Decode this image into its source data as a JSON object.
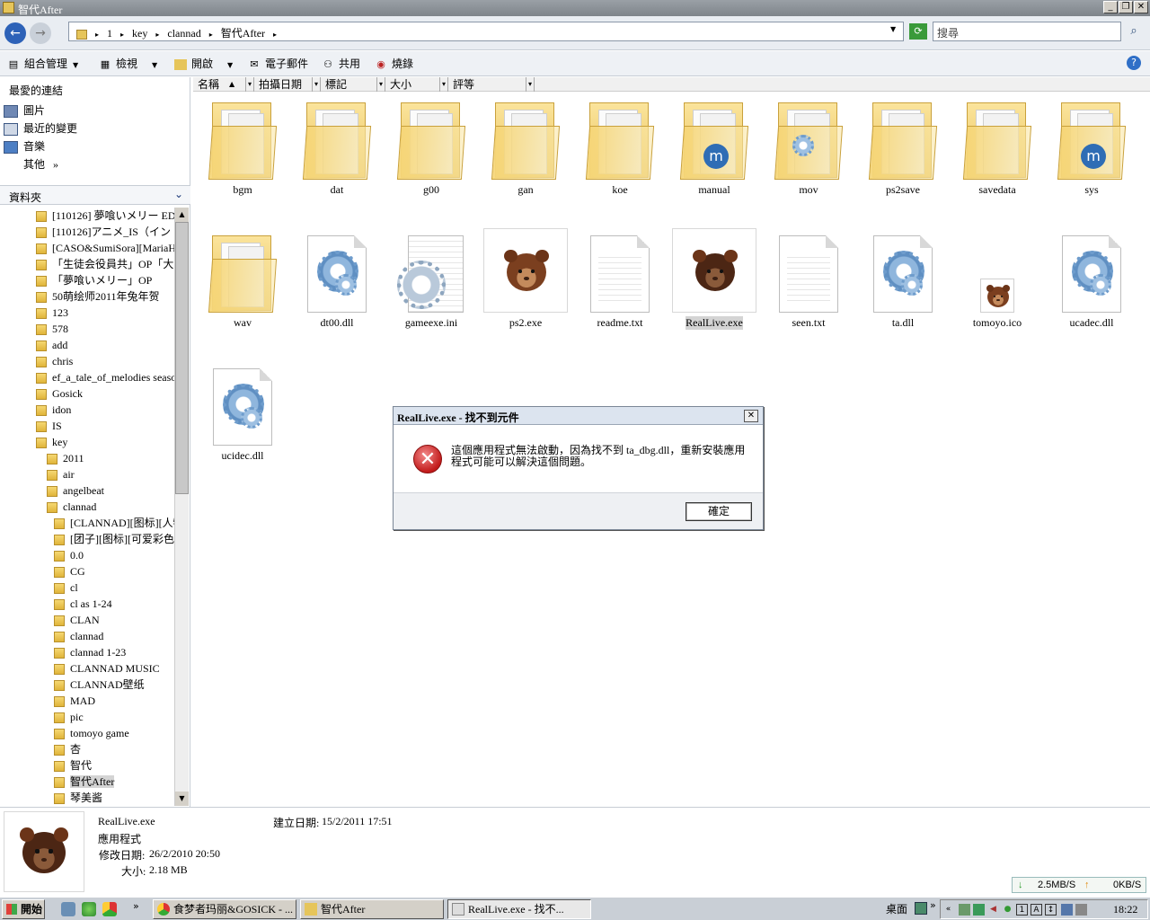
{
  "window": {
    "title": "智代After"
  },
  "address": {
    "crumbs": [
      "1",
      "key",
      "clannad",
      "智代After"
    ],
    "search_placeholder": "搜尋"
  },
  "toolbar": {
    "organize": "組合管理",
    "views": "檢視",
    "open": "開啟",
    "email": "電子郵件",
    "share": "共用",
    "burn": "燒錄"
  },
  "nav": {
    "favorites_title": "最愛的連結",
    "favorites": [
      "圖片",
      "最近的變更",
      "音樂"
    ],
    "more": "其他",
    "more_arrows": "»",
    "folders_title": "資料夾",
    "tree": [
      "[110126] 夢喰いメリー ED",
      "[110126]アニメ_IS（イン",
      "[CASO&SumiSora][MariaHo",
      "「生徒会役員共」OP「大",
      "「夢喰いメリー」OP",
      "50萌绘师2011年兔年贺",
      "123",
      "578",
      "add",
      "chris",
      "ef_a_tale_of_melodies season",
      "Gosick",
      "idon",
      "IS",
      "key",
      "2011",
      "air",
      "angelbeat",
      "clannad",
      "[CLANNAD][图标][人物",
      "[团子][图标][可爱彩色",
      "0.0",
      "CG",
      "cl",
      "cl as 1-24",
      "CLAN",
      "clannad",
      "clannad 1-23",
      "CLANNAD MUSIC",
      "CLANNAD壁纸",
      "MAD",
      "pic",
      "tomoyo game",
      "杏",
      "智代",
      "智代After",
      "琴美酱"
    ]
  },
  "columns": [
    "名稱",
    "拍攝日期",
    "標記",
    "大小",
    "評等"
  ],
  "files": [
    {
      "name": "bgm",
      "type": "folder"
    },
    {
      "name": "dat",
      "type": "folder"
    },
    {
      "name": "g00",
      "type": "folder"
    },
    {
      "name": "gan",
      "type": "folder"
    },
    {
      "name": "koe",
      "type": "folder"
    },
    {
      "name": "manual",
      "type": "folder-badge"
    },
    {
      "name": "mov",
      "type": "folder-gear"
    },
    {
      "name": "ps2save",
      "type": "folder"
    },
    {
      "name": "savedata",
      "type": "folder"
    },
    {
      "name": "sys",
      "type": "folder-badge"
    },
    {
      "name": "wav",
      "type": "folder"
    },
    {
      "name": "dt00.dll",
      "type": "dll"
    },
    {
      "name": "gameexe.ini",
      "type": "ini"
    },
    {
      "name": "ps2.exe",
      "type": "exe"
    },
    {
      "name": "readme.txt",
      "type": "txt"
    },
    {
      "name": "RealLive.exe",
      "type": "exe-dark"
    },
    {
      "name": "seen.txt",
      "type": "txt"
    },
    {
      "name": "ta.dll",
      "type": "dll"
    },
    {
      "name": "tomoyo.ico",
      "type": "ico"
    },
    {
      "name": "ucadec.dll",
      "type": "dll"
    },
    {
      "name": "ucidec.dll",
      "type": "dll"
    }
  ],
  "details": {
    "name": "RealLive.exe",
    "kind": "應用程式",
    "modified_label": "修改日期:",
    "modified": "26/2/2010 20:50",
    "size_label": "大小:",
    "size": "2.18 MB",
    "created_label": "建立日期:",
    "created": "15/2/2011 17:51"
  },
  "speed": {
    "down": "2.5MB/S",
    "up": "0KB/S"
  },
  "dialog": {
    "title": "RealLive.exe - 找不到元件",
    "message": "這個應用程式無法啟動，因為找不到 ta_dbg.dll，重新安裝應用程式可能可以解決這個問題。",
    "ok": "確定"
  },
  "taskbar": {
    "start": "開始",
    "tasks": [
      "食梦者玛丽&GOSICK - ...",
      "智代After",
      "RealLive.exe - 找不..."
    ],
    "desktop": "桌面",
    "clock": "18:22"
  },
  "colors": {
    "selection": "#d4d4d4",
    "folder": "#f0cd6a",
    "error": "#c21b1b"
  }
}
